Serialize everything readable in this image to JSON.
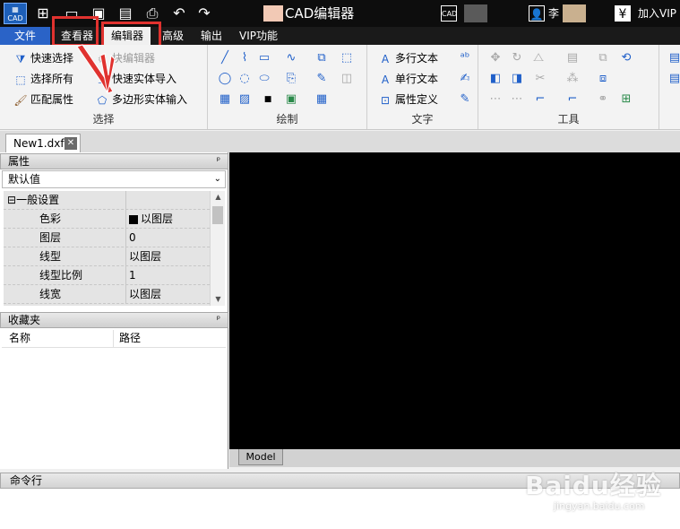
{
  "titlebar": {
    "app_logo": "CAD",
    "title": "CAD编辑器",
    "right_icon_label": "CAD",
    "right_text_1": "李",
    "right_text_2": "加入VIP",
    "currency_icon": "¥",
    "quick_access": [
      "new-icon",
      "open-icon",
      "save-icon",
      "save-as-icon",
      "print-icon",
      "undo-icon",
      "redo-icon"
    ]
  },
  "menubar": {
    "file": "文件",
    "tabs": [
      "查看器",
      "编辑器",
      "高级",
      "输出",
      "VIP功能"
    ],
    "active_tab": "编辑器"
  },
  "ribbon": {
    "select_group": {
      "title": "选择",
      "buttons": [
        "快速选择",
        "选择所有",
        "匹配属性",
        "块编辑器",
        "快速实体导入",
        "多边形实体输入"
      ]
    },
    "draw_group": {
      "title": "绘制"
    },
    "text_group": {
      "title": "文字",
      "buttons": [
        "多行文本",
        "单行文本",
        "属性定义"
      ]
    },
    "tools_group": {
      "title": "工具"
    }
  },
  "document_tab": {
    "name": "New1.dxf",
    "close": "✕"
  },
  "properties_panel": {
    "title": "属性",
    "pin": "ᵖ",
    "dropdown_value": "默认值",
    "section": "一般设置",
    "rows": [
      {
        "key": "色彩",
        "value": "以图层"
      },
      {
        "key": "图层",
        "value": "0"
      },
      {
        "key": "线型",
        "value": "以图层"
      },
      {
        "key": "线型比例",
        "value": "1"
      },
      {
        "key": "线宽",
        "value": "以图层"
      }
    ]
  },
  "favorites_panel": {
    "title": "收藏夹",
    "columns": [
      "名称",
      "路径"
    ]
  },
  "canvas": {
    "model_tab": "Model"
  },
  "command_line": {
    "title": "命令行"
  },
  "watermark": {
    "brand": "Baidu经验",
    "url": "jingyan.baidu.com"
  },
  "colors": {
    "file_menu": "#2a63c7",
    "highlight": "#e0322f",
    "canvas": "#000000",
    "accent": "#1f5fc9"
  }
}
